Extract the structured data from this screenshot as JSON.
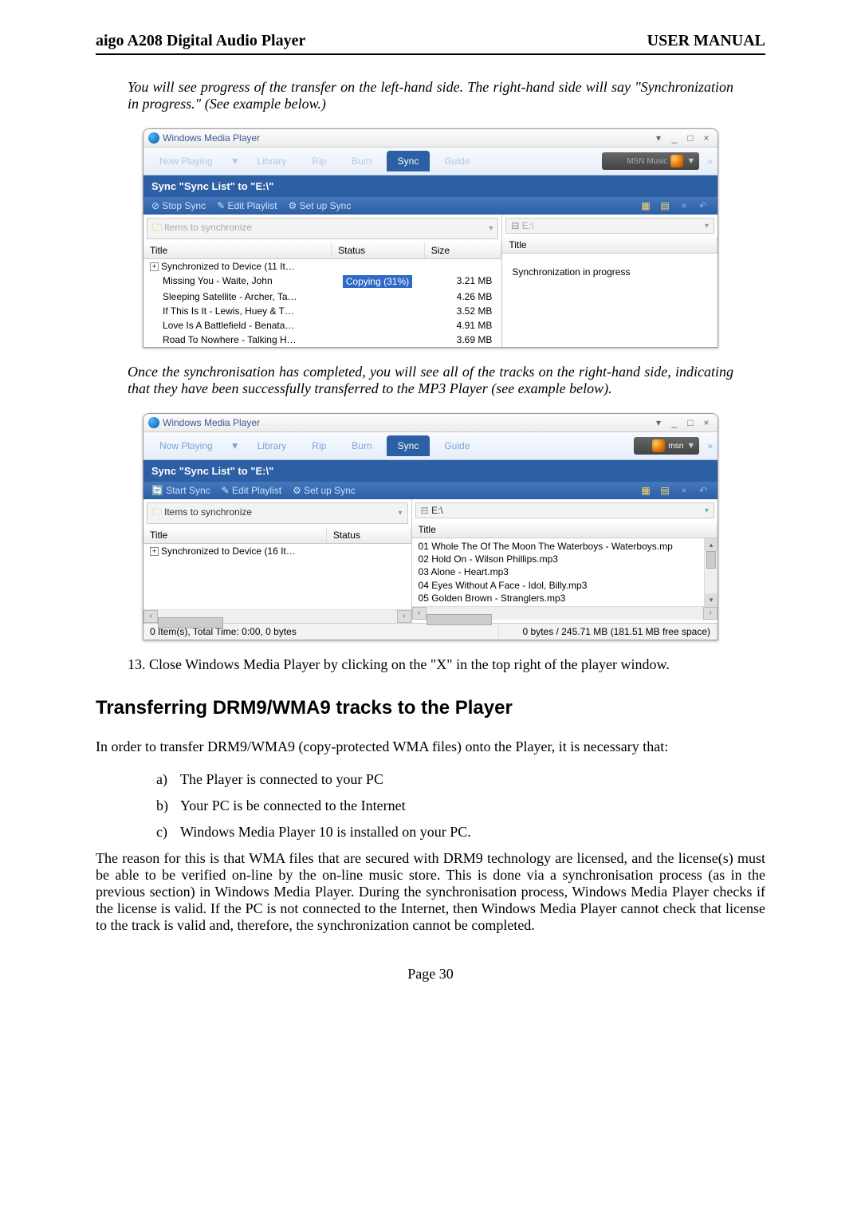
{
  "header": {
    "left": "aigo A208 Digital Audio Player",
    "right": "USER MANUAL"
  },
  "para1": "You will see progress of the transfer on the left-hand side.   The right-hand side will say \"Synchronization in progress.\"   (See example below.)",
  "wmp1": {
    "title": "Windows Media Player",
    "tabs": {
      "now_playing": "Now Playing",
      "library": "Library",
      "rip": "Rip",
      "burn": "Burn",
      "sync": "Sync",
      "guide": "Guide"
    },
    "msn": {
      "label": "MSN Music",
      "sub": "msn"
    },
    "syncbar": "Sync \"Sync List\" to \"E:\\\"",
    "actions": {
      "stop_sync": "Stop Sync",
      "edit_playlist": "Edit Playlist",
      "setup_sync": "Set up Sync"
    },
    "dropdown_left": "Items to synchronize",
    "dropdown_right": "E:\\",
    "heads": {
      "title": "Title",
      "status": "Status",
      "size": "Size",
      "right_title": "Title"
    },
    "rows": [
      {
        "title": "Synchronized to Device (11 It…",
        "status": "",
        "size": "",
        "tree": true
      },
      {
        "title": "Missing You - Waite, John",
        "status": "Copying (31%)",
        "size": "3.21 MB"
      },
      {
        "title": "Sleeping Satellite - Archer, Ta…",
        "status": "",
        "size": "4.26 MB"
      },
      {
        "title": "If This Is It - Lewis, Huey & T…",
        "status": "",
        "size": "3.52 MB"
      },
      {
        "title": "Love Is A Battlefield - Benata…",
        "status": "",
        "size": "4.91 MB"
      },
      {
        "title": "Road To Nowhere - Talking H…",
        "status": "",
        "size": "3.69 MB"
      }
    ],
    "right_text": "Synchronization in progress"
  },
  "para2": "Once the synchronisation has completed, you will see all of the tracks on the right-hand side, indicating that they have been successfully transferred to the MP3 Player (see example below).",
  "wmp2": {
    "title": "Windows Media Player",
    "tabs": {
      "now_playing": "Now Playing",
      "library": "Library",
      "rip": "Rip",
      "burn": "Burn",
      "sync": "Sync",
      "guide": "Guide"
    },
    "msn": {
      "sub": "msn"
    },
    "syncbar": "Sync \"Sync List\" to \"E:\\\"",
    "actions": {
      "start_sync": "Start Sync",
      "edit_playlist": "Edit Playlist",
      "setup_sync": "Set up Sync"
    },
    "dropdown_left": "Items to synchronize",
    "dropdown_right": "E:\\",
    "heads": {
      "title": "Title",
      "status": "Status",
      "right_title": "Title"
    },
    "left_row": "Synchronized to Device (16 It…",
    "right_rows": [
      "01 Whole The Of The Moon The Waterboys - Waterboys.mp",
      "02 Hold On - Wilson Phillips.mp3",
      "03 Alone - Heart.mp3",
      "04 Eyes Without A Face - Idol, Billy.mp3",
      "05 Golden Brown - Stranglers.mp3"
    ],
    "status_left": "0 Item(s), Total Time: 0:00, 0 bytes",
    "status_right": "0 bytes / 245.71 MB (181.51 MB free space)"
  },
  "num13": "13.  Close Windows Media Player by clicking on the \"X\" in the top right of the player window.",
  "heading2": "Transferring DRM9/WMA9 tracks to the Player",
  "para3": "In order to transfer DRM9/WMA9 (copy-protected WMA files) onto the Player, it is necessary that:",
  "list": {
    "a": {
      "label": "a)",
      "text": "The Player is connected to your PC"
    },
    "b": {
      "label": "b)",
      "text": "Your PC is be connected to the Internet"
    },
    "c": {
      "label": "c)",
      "text": "Windows Media Player 10 is installed on your PC."
    }
  },
  "para4": "The reason for this is that WMA files that are secured with DRM9 technology are licensed, and the license(s) must be able to be verified on-line by the on-line music store.   This is done via a synchronisation process (as in the previous section) in Windows Media Player.   During the synchronisation process, Windows Media Player checks if the license is valid.   If the PC is not connected to the Internet, then Windows Media Player cannot check that license to the track is valid and, therefore, the synchronization cannot be completed.",
  "page_num": "Page 30"
}
